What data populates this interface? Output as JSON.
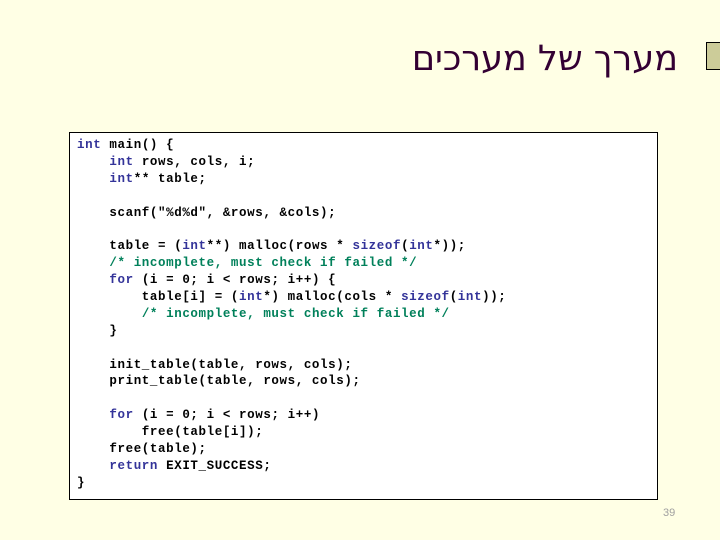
{
  "slide": {
    "title": "מערך של מערכים",
    "number": "39",
    "colors": {
      "background": "#ffffe5",
      "title": "#330033",
      "keyword": "#333399",
      "comment": "#00805a",
      "bullet": "#cccc99"
    }
  },
  "code": {
    "lines": [
      [
        {
          "t": "int",
          "c": "kw"
        },
        {
          "t": " main() {",
          "c": ""
        }
      ],
      [
        {
          "t": "    ",
          "c": ""
        },
        {
          "t": "int",
          "c": "kw"
        },
        {
          "t": " rows, cols, i;",
          "c": ""
        }
      ],
      [
        {
          "t": "    ",
          "c": ""
        },
        {
          "t": "int",
          "c": "kw"
        },
        {
          "t": "** table;",
          "c": ""
        }
      ],
      [],
      [
        {
          "t": "    scanf(\"%d%d\", &rows, &cols);",
          "c": ""
        }
      ],
      [],
      [
        {
          "t": "    table = (",
          "c": ""
        },
        {
          "t": "int",
          "c": "kw"
        },
        {
          "t": "**) malloc(rows * ",
          "c": ""
        },
        {
          "t": "sizeof",
          "c": "kw"
        },
        {
          "t": "(",
          "c": ""
        },
        {
          "t": "int",
          "c": "kw"
        },
        {
          "t": "*));",
          "c": ""
        }
      ],
      [
        {
          "t": "    ",
          "c": ""
        },
        {
          "t": "/* incomplete, must check if failed */",
          "c": "cm"
        }
      ],
      [
        {
          "t": "    ",
          "c": ""
        },
        {
          "t": "for",
          "c": "kw"
        },
        {
          "t": " (i = 0; i < rows; i++) {",
          "c": ""
        }
      ],
      [
        {
          "t": "        table[i] = (",
          "c": ""
        },
        {
          "t": "int",
          "c": "kw"
        },
        {
          "t": "*) malloc(cols * ",
          "c": ""
        },
        {
          "t": "sizeof",
          "c": "kw"
        },
        {
          "t": "(",
          "c": ""
        },
        {
          "t": "int",
          "c": "kw"
        },
        {
          "t": "));",
          "c": ""
        }
      ],
      [
        {
          "t": "        ",
          "c": ""
        },
        {
          "t": "/* incomplete, must check if failed */",
          "c": "cm"
        }
      ],
      [
        {
          "t": "    }",
          "c": ""
        }
      ],
      [],
      [
        {
          "t": "    init_table(table, rows, cols);",
          "c": ""
        }
      ],
      [
        {
          "t": "    print_table(table, rows, cols);",
          "c": ""
        }
      ],
      [],
      [
        {
          "t": "    ",
          "c": ""
        },
        {
          "t": "for",
          "c": "kw"
        },
        {
          "t": " (i = 0; i < rows; i++)",
          "c": ""
        }
      ],
      [
        {
          "t": "        free(table[i]);",
          "c": ""
        }
      ],
      [
        {
          "t": "    free(table);",
          "c": ""
        }
      ],
      [
        {
          "t": "    ",
          "c": ""
        },
        {
          "t": "return",
          "c": "kw"
        },
        {
          "t": " EXIT_SUCCESS;",
          "c": ""
        }
      ],
      [
        {
          "t": "}",
          "c": ""
        }
      ]
    ]
  }
}
